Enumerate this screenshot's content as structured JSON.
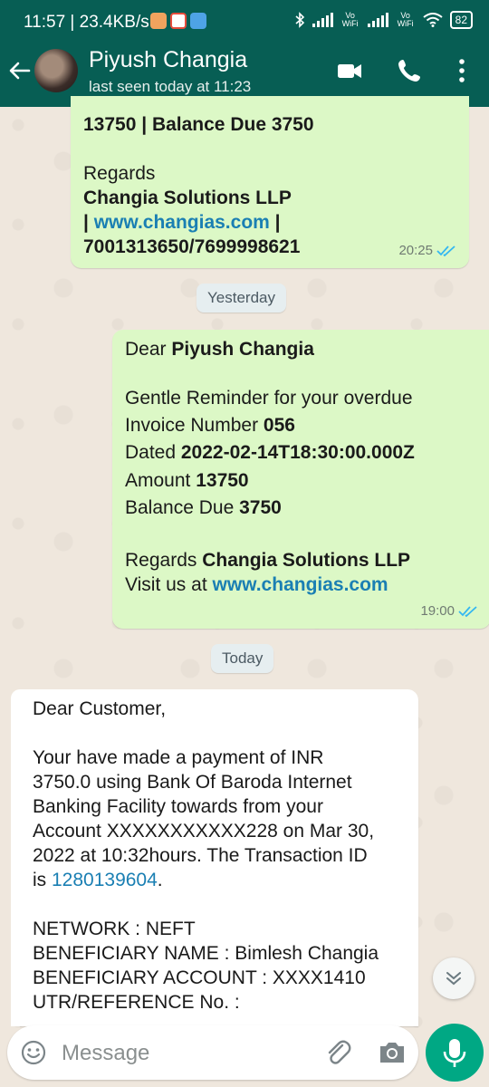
{
  "status_bar": {
    "time_speed": "11:57 | 23.4KB/s",
    "vowifi_1": "Vo WiFi",
    "vowifi_2": "Vo WiFi",
    "battery": "82"
  },
  "header": {
    "contact_name": "Piyush Changia",
    "last_seen": "last seen today at 11:23"
  },
  "messages": {
    "m1": {
      "line1": "13750 | Balance Due 3750",
      "line2": "Regards",
      "line3": "Changia Solutions LLP",
      "line4_prefix": "| ",
      "line4_link": "www.changias.com",
      "line4_suffix": " |",
      "line5": "7001313650/7699998621",
      "time": "20:25"
    },
    "date_yesterday": "Yesterday",
    "m2": {
      "dear": "Dear ",
      "dear_name": "Piyush Changia",
      "reminder": "Gentle Reminder for your overdue",
      "invoice_label": "Invoice Number ",
      "invoice_value": "056",
      "dated_label": "Dated ",
      "dated_value": "2022-02-14T18:30:00.000Z",
      "amount_label": "Amount ",
      "amount_value": "13750",
      "balance_label": "Balance Due ",
      "balance_value": "3750",
      "regards_label": "Regards ",
      "regards_value": "Changia Solutions LLP",
      "visit_label": "Visit us at ",
      "visit_link": "www.changias.com",
      "time": "19:00"
    },
    "date_today": "Today",
    "m3": {
      "greeting": "Dear Customer,",
      "body_l1": "Your have made a payment of INR",
      "body_l2": "3750.0 using Bank Of Baroda Internet",
      "body_l3": "Banking Facility towards from your",
      "body_l4": "Account XXXXXXXXXXX228 on Mar 30,",
      "body_l5": "2022 at 10:32hours. The Transaction ID",
      "body_l6_prefix": "is ",
      "transaction_id": "1280139604",
      "body_l6_suffix": ".",
      "network": "NETWORK : NEFT",
      "beneficiary_name": "BENEFICIARY NAME : Bimlesh Changia",
      "beneficiary_account": "BENEFICIARY ACCOUNT : XXXX1410",
      "utr": "UTR/REFERENCE No. :"
    }
  },
  "input": {
    "placeholder": "Message"
  },
  "colors": {
    "header": "#075e54",
    "outgoing_bubble": "#dcf8c6",
    "incoming_bubble": "#ffffff",
    "link": "#1a7fb3",
    "read_ticks": "#34b7f1",
    "mic_button": "#00a884"
  },
  "icons": [
    "back-arrow-icon",
    "video-call-icon",
    "phone-icon",
    "more-vert-icon",
    "double-check-icon",
    "chevron-down-icon",
    "emoji-icon",
    "attach-icon",
    "camera-icon",
    "mic-icon"
  ]
}
